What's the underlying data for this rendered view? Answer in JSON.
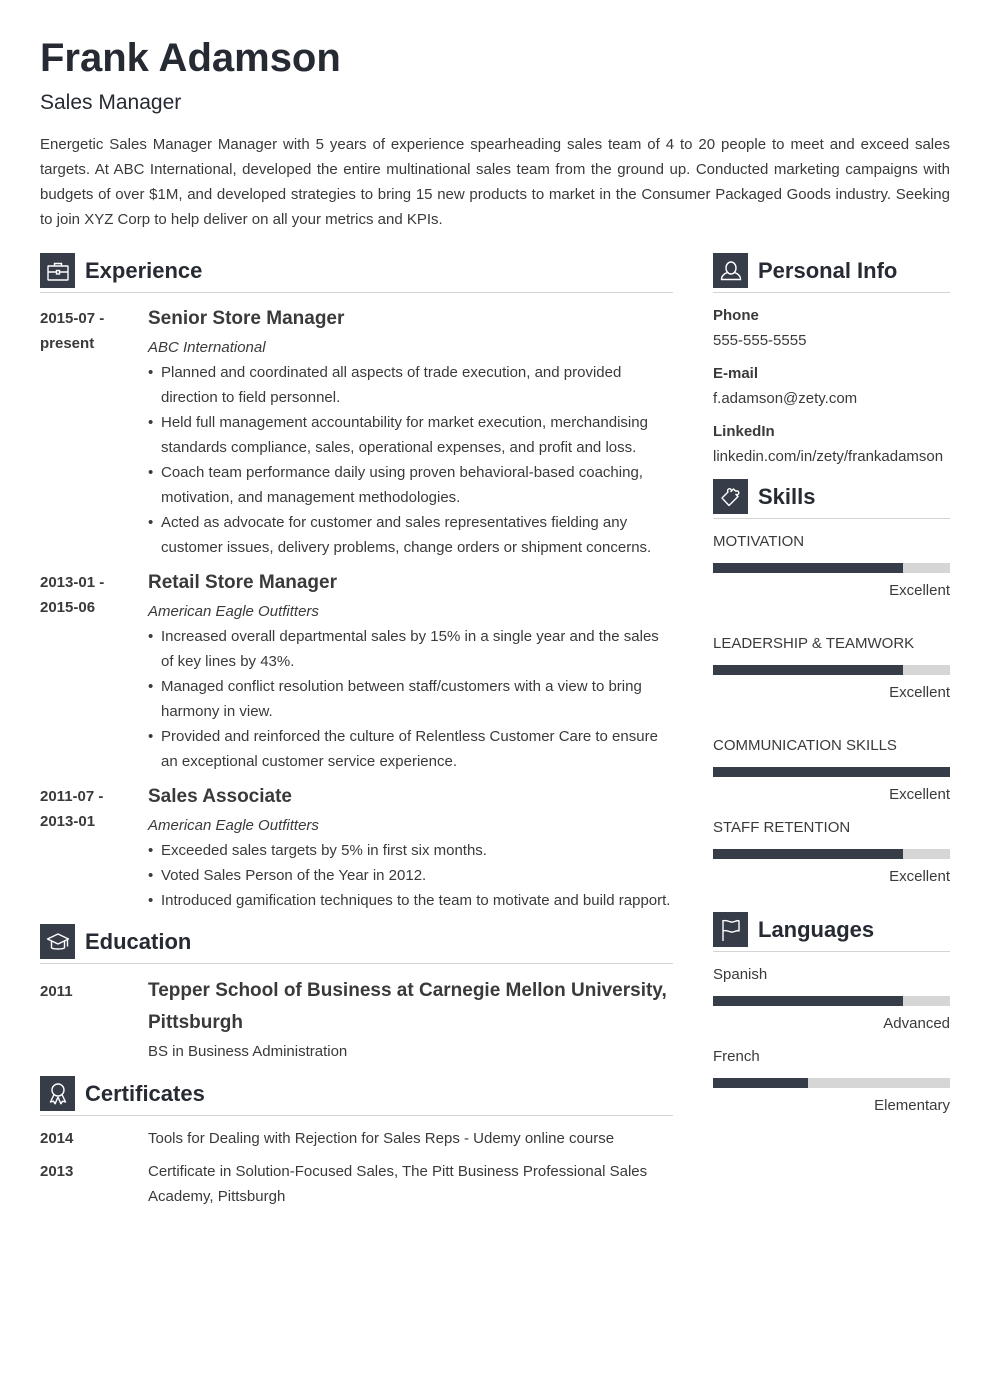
{
  "header": {
    "name": "Frank Adamson",
    "title": "Sales Manager",
    "summary": "Energetic Sales Manager Manager with 5 years of experience spearheading sales team of 4 to 20 people to meet and exceed sales targets. At ABC International, developed the entire multinational sales team from the ground up. Conducted marketing campaigns with budgets of over $1M, and developed strategies to bring 15 new products to market in the Consumer Packaged Goods industry. Seeking to join XYZ Corp to help deliver on all your metrics and KPIs."
  },
  "colors": {
    "accent": "#363c48",
    "bar_track": "#d6d6d6",
    "rule": "#d4d4d4",
    "text": "#3a3a3a"
  },
  "experience": {
    "heading": "Experience",
    "icon": "briefcase-icon",
    "items": [
      {
        "date_start": "2015-07 -",
        "date_end": "present",
        "role": "Senior Store Manager",
        "company": "ABC International",
        "bullets": [
          "Planned and coordinated all aspects of trade execution, and provided direction to field personnel.",
          "Held full management accountability for market execution, merchandising standards compliance, sales, operational expenses, and profit and loss.",
          "Coach team performance daily using proven behavioral-based coaching, motivation, and management methodologies.",
          "Acted as advocate for customer and sales representatives fielding any customer issues, delivery problems, change orders or shipment concerns."
        ]
      },
      {
        "date_start": "2013-01 -",
        "date_end": "2015-06",
        "role": "Retail Store Manager",
        "company": "American Eagle Outfitters",
        "bullets": [
          "Increased overall departmental sales by 15% in a single year and the sales of key lines by 43%.",
          "Managed conflict resolution between staff/customers with a view to bring harmony in view.",
          "Provided and reinforced the culture of Relentless Customer Care to ensure an exceptional customer service experience."
        ]
      },
      {
        "date_start": "2011-07 -",
        "date_end": "2013-01",
        "role": "Sales Associate",
        "company": "American Eagle Outfitters",
        "bullets": [
          "Exceeded sales targets by 5% in first six months.",
          "Voted Sales Person of the Year in 2012.",
          "Introduced gamification techniques to the team to motivate and build rapport."
        ]
      }
    ]
  },
  "education": {
    "heading": "Education",
    "icon": "graduation-cap-icon",
    "items": [
      {
        "year": "2011",
        "school": "Tepper School of Business at Carnegie Mellon University, Pittsburgh",
        "degree": "BS in Business Administration"
      }
    ]
  },
  "certificates": {
    "heading": "Certificates",
    "icon": "award-ribbon-icon",
    "items": [
      {
        "year": "2014",
        "text": "Tools for Dealing with Rejection for Sales Reps - Udemy online course"
      },
      {
        "year": "2013",
        "text": "Certificate in Solution-Focused Sales, The Pitt Business Professional Sales Academy, Pittsburgh"
      }
    ]
  },
  "personal_info": {
    "heading": "Personal Info",
    "icon": "person-icon",
    "items": [
      {
        "label": "Phone",
        "value": "555-555-5555"
      },
      {
        "label": "E-mail",
        "value": "f.adamson@zety.com"
      },
      {
        "label": "LinkedIn",
        "value": "linkedin.com/in/zety/frankadamson"
      }
    ]
  },
  "skills": {
    "heading": "Skills",
    "icon": "puzzle-piece-icon",
    "items": [
      {
        "name": "MOTIVATION",
        "level": "Excellent",
        "fraction": 0.8
      },
      {
        "name": "LEADERSHIP & TEAMWORK",
        "level": "Excellent",
        "fraction": 0.8
      },
      {
        "name": "COMMUNICATION SKILLS",
        "level": "Excellent",
        "fraction": 1.0
      },
      {
        "name": "STAFF RETENTION",
        "level": "Excellent",
        "fraction": 0.8
      }
    ]
  },
  "languages": {
    "heading": "Languages",
    "icon": "flag-icon",
    "items": [
      {
        "name": "Spanish",
        "level": "Advanced",
        "fraction": 0.8
      },
      {
        "name": "French",
        "level": "Elementary",
        "fraction": 0.4
      }
    ]
  }
}
